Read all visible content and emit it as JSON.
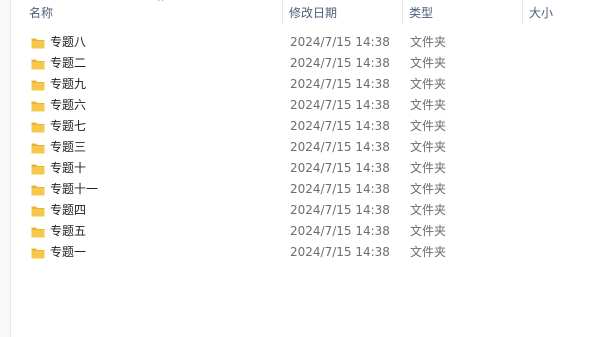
{
  "columns": {
    "name": "名称",
    "date": "修改日期",
    "type": "类型",
    "size": "大小"
  },
  "colors": {
    "header_text": "#4c607a",
    "folder": "#f5c74b",
    "secondary_text": "#6d6d6d"
  },
  "files": [
    {
      "name": "专题八",
      "date": "2024/7/15 14:38",
      "type": "文件夹"
    },
    {
      "name": "专题二",
      "date": "2024/7/15 14:38",
      "type": "文件夹"
    },
    {
      "name": "专题九",
      "date": "2024/7/15 14:38",
      "type": "文件夹"
    },
    {
      "name": "专题六",
      "date": "2024/7/15 14:38",
      "type": "文件夹"
    },
    {
      "name": "专题七",
      "date": "2024/7/15 14:38",
      "type": "文件夹"
    },
    {
      "name": "专题三",
      "date": "2024/7/15 14:38",
      "type": "文件夹"
    },
    {
      "name": "专题十",
      "date": "2024/7/15 14:38",
      "type": "文件夹"
    },
    {
      "name": "专题十一",
      "date": "2024/7/15 14:38",
      "type": "文件夹"
    },
    {
      "name": "专题四",
      "date": "2024/7/15 14:38",
      "type": "文件夹"
    },
    {
      "name": "专题五",
      "date": "2024/7/15 14:38",
      "type": "文件夹"
    },
    {
      "name": "专题一",
      "date": "2024/7/15 14:38",
      "type": "文件夹"
    }
  ]
}
